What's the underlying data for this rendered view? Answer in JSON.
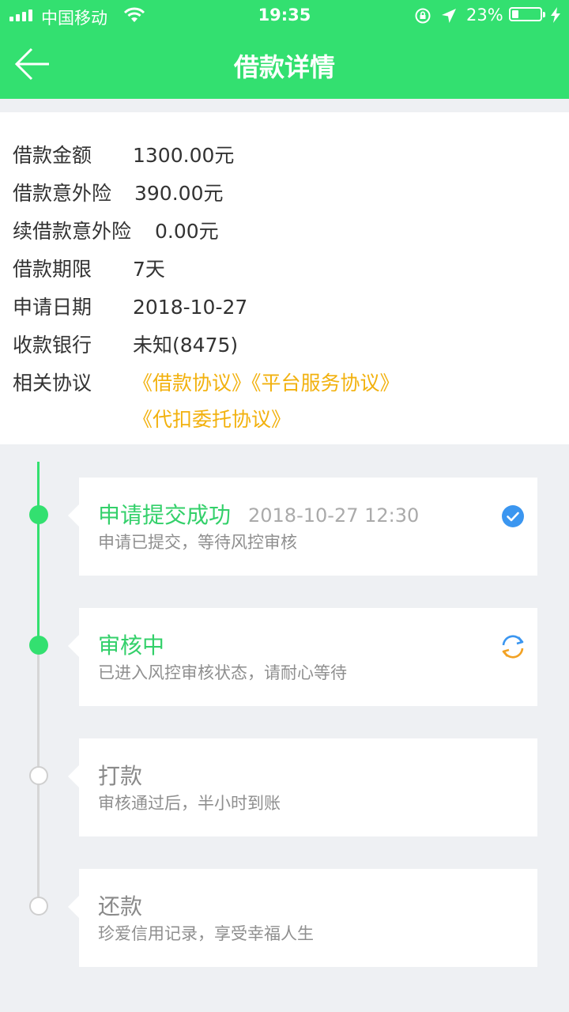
{
  "status_bar": {
    "carrier": "中国移动",
    "time": "19:35",
    "battery": "23%",
    "battery_level": 0.23
  },
  "header": {
    "title": "借款详情"
  },
  "loan": {
    "rows": [
      {
        "label": "借款金额",
        "value": "1300.00元"
      },
      {
        "label": "借款意外险",
        "value": "390.00元"
      },
      {
        "label": "续借款意外险",
        "value": "0.00元"
      },
      {
        "label": "借款期限",
        "value": "7天"
      },
      {
        "label": "申请日期",
        "value": "2018-10-27"
      },
      {
        "label": "收款银行",
        "value": "未知(8475)"
      }
    ],
    "agreements_label": "相关协议",
    "agreements": [
      "《借款协议》",
      "《平台服务协议》",
      "《代扣委托协议》"
    ]
  },
  "timeline": [
    {
      "title": "申请提交成功",
      "time": "2018-10-27 12:30",
      "desc": "申请已提交，等待风控审核",
      "state": "done",
      "icon": "check-circle-icon"
    },
    {
      "title": "审核中",
      "time": "",
      "desc": "已进入风控审核状态，请耐心等待",
      "state": "active",
      "icon": "refresh-icon"
    },
    {
      "title": "打款",
      "time": "",
      "desc": "审核通过后，半小时到账",
      "state": "pending",
      "icon": ""
    },
    {
      "title": "还款",
      "time": "",
      "desc": "珍爱信用记录，享受幸福人生",
      "state": "pending",
      "icon": ""
    }
  ],
  "colors": {
    "primary_green": "#33e070",
    "agreement_gold": "#f2b10e",
    "check_blue": "#3b96f0",
    "refresh_orange": "#f2a224",
    "refresh_blue": "#3b96f0"
  }
}
